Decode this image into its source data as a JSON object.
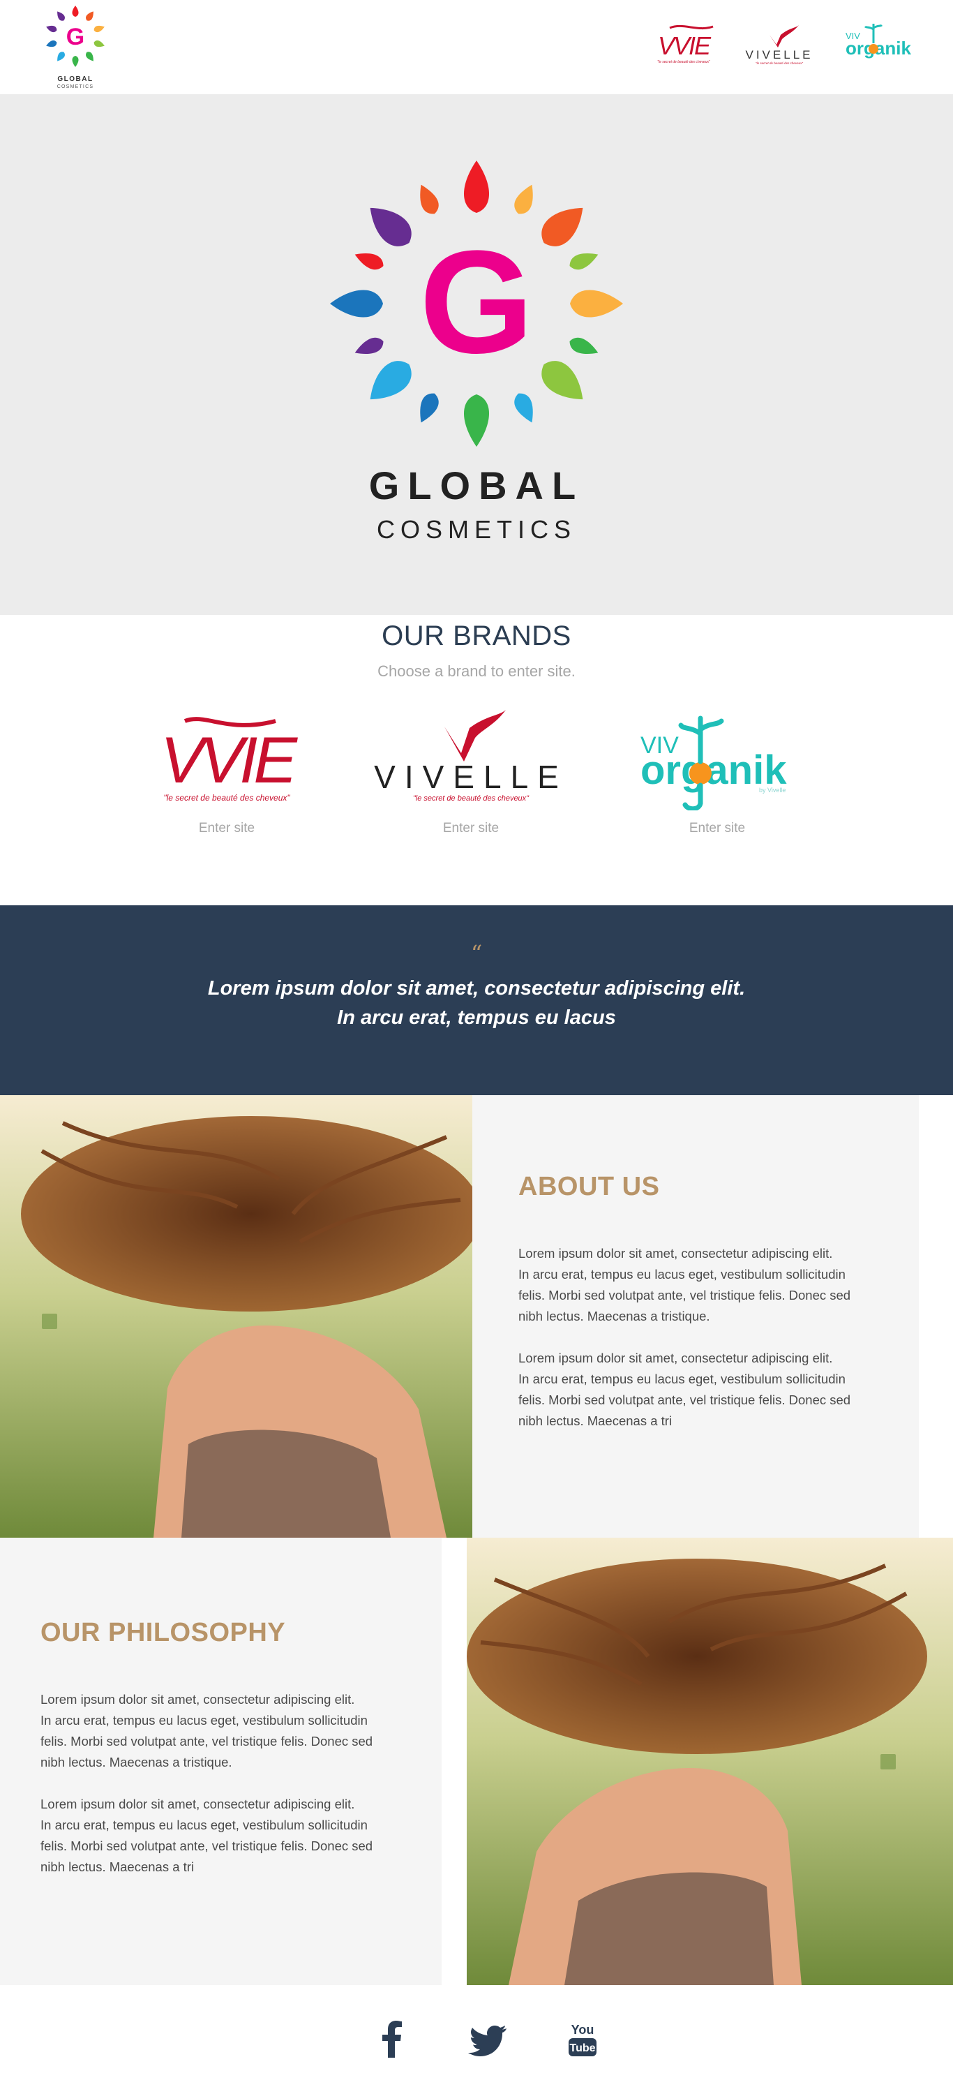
{
  "header": {
    "logo": {
      "mark": "G",
      "line1": "GLOBAL",
      "line2": "COSMETICS"
    },
    "brand_links": [
      {
        "name": "VVIE",
        "tagline": "\"le secret de beauté des cheveux\""
      },
      {
        "name": "VIVELLE",
        "tagline": "\"le secret de beauté des cheveux\""
      },
      {
        "name": "VIV organik",
        "prefix": "VIV",
        "word": "organik"
      }
    ]
  },
  "hero": {
    "mark": "G",
    "title": "GLOBAL",
    "subtitle": "COSMETICS",
    "petal_colors": [
      "#ee1c25",
      "#f15a24",
      "#f7941d",
      "#fbb040",
      "#8dc63f",
      "#39b54a",
      "#29abe2",
      "#1b75bc",
      "#662d91",
      "#9e1f63"
    ],
    "mark_color": "#ec008c"
  },
  "brands": {
    "title": "OUR BRANDS",
    "subtitle": "Choose a brand to enter site.",
    "items": [
      {
        "name": "VVIE",
        "tagline": "\"le secret de beauté des cheveux\"",
        "cta": "Enter site"
      },
      {
        "name": "VIVELLE",
        "tagline": "\"le secret de beauté des cheveux\"",
        "cta": "Enter site"
      },
      {
        "name": "VIV organik",
        "prefix": "VIV",
        "word": "organik",
        "byline": "by Vivelle",
        "cta": "Enter site"
      }
    ]
  },
  "quote": {
    "mark": "“",
    "line1": "Lorem ipsum dolor sit amet, consectetur adipiscing elit.",
    "line2": "In arcu erat, tempus eu lacus"
  },
  "about": {
    "title": "ABOUT US",
    "paragraph1": "Lorem ipsum dolor sit amet, consectetur adipiscing elit.\n In arcu erat, tempus eu lacus eget, vestibulum sollicitudin\nfelis. Morbi sed volutpat ante, vel tristique felis. Donec sed\nnibh lectus. Maecenas a tristique.",
    "paragraph2": "Lorem ipsum dolor sit amet, consectetur adipiscing elit.\n In arcu erat, tempus eu lacus eget, vestibulum sollicitudin\nfelis. Morbi sed volutpat ante, vel tristique felis. Donec sed\nnibh lectus. Maecenas a tri"
  },
  "philosophy": {
    "title": "OUR PHILOSOPHY",
    "paragraph1": "Lorem ipsum dolor sit amet, consectetur adipiscing elit.\n In arcu erat, tempus eu lacus eget, vestibulum sollicitudin\nfelis. Morbi sed volutpat ante, vel tristique felis. Donec sed\nnibh lectus. Maecenas a tristique.",
    "paragraph2": "Lorem ipsum dolor sit amet, consectetur adipiscing elit.\n In arcu erat, tempus eu lacus eget, vestibulum sollicitudin\nfelis. Morbi sed volutpat ante, vel tristique felis. Donec sed\nnibh lectus. Maecenas a tri"
  },
  "footer": {
    "social": [
      {
        "icon": "facebook-icon"
      },
      {
        "icon": "twitter-icon"
      },
      {
        "icon": "youtube-icon",
        "label_top": "You",
        "label_bottom": "Tube"
      }
    ]
  },
  "colors": {
    "accent": "#b89468",
    "navy": "#2c3e55",
    "brand_red": "#c8102e",
    "organik_teal": "#1fbfb8",
    "organik_orange": "#f7941d",
    "muted": "#a6a6a6"
  }
}
